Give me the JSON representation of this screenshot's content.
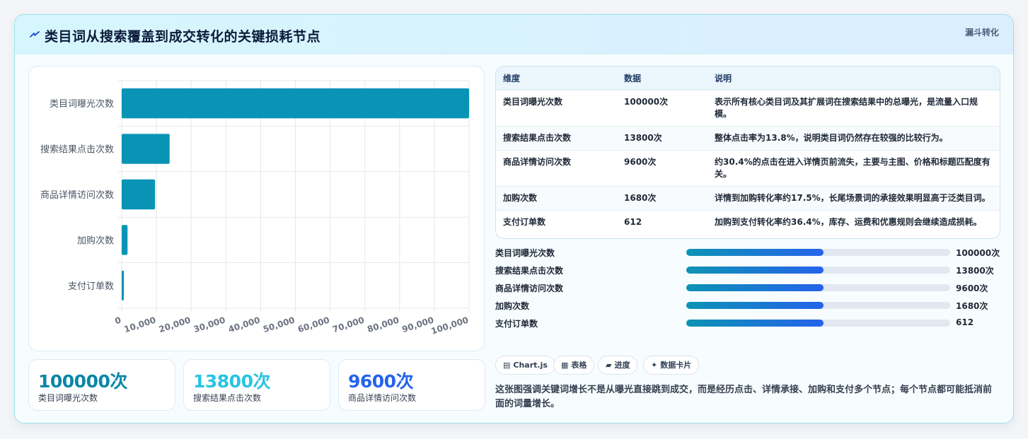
{
  "header": {
    "title": "类目词从搜索覆盖到成交转化的关键损耗节点",
    "badge": "漏斗转化",
    "icon": "lightning-icon"
  },
  "chart_data": {
    "type": "bar",
    "orientation": "horizontal",
    "categories": [
      "类目词曝光次数",
      "搜索结果点击次数",
      "商品详情访问次数",
      "加购次数",
      "支付订单数"
    ],
    "values": [
      100000,
      13800,
      9600,
      1680,
      612
    ],
    "xlim": [
      0,
      100000
    ],
    "ticks": [
      "0",
      "10,000",
      "20,000",
      "30,000",
      "40,000",
      "50,000",
      "60,000",
      "70,000",
      "80,000",
      "90,000",
      "100,000"
    ],
    "grid": true,
    "bar_color": "#0994b6"
  },
  "kpis": [
    {
      "value": "100000次",
      "label": "类目词曝光次数",
      "color": "#0b87a8"
    },
    {
      "value": "13800次",
      "label": "搜索结果点击次数",
      "color": "#29c3e3"
    },
    {
      "value": "9600次",
      "label": "商品详情访问次数",
      "color": "#2563eb"
    }
  ],
  "table": {
    "headers": [
      "维度",
      "数据",
      "说明"
    ],
    "rows": [
      [
        "类目词曝光次数",
        "100000次",
        "表示所有核心类目词及其扩展词在搜索结果中的总曝光，是流量入口规模。"
      ],
      [
        "搜索结果点击次数",
        "13800次",
        "整体点击率为13.8%，说明类目词仍然存在较强的比较行为。"
      ],
      [
        "商品详情访问次数",
        "9600次",
        "约30.4%的点击在进入详情页前流失，主要与主图、价格和标题匹配度有关。"
      ],
      [
        "加购次数",
        "1680次",
        "详情到加购转化率约17.5%，长尾场景词的承接效果明显高于泛类目词。"
      ],
      [
        "支付订单数",
        "612",
        "加购到支付转化率约36.4%，库存、运费和优惠规则会继续造成损耗。"
      ]
    ]
  },
  "progress": [
    {
      "label": "类目词曝光次数",
      "value": "100000次",
      "fill": 0.52
    },
    {
      "label": "搜索结果点击次数",
      "value": "13800次",
      "fill": 0.52
    },
    {
      "label": "商品详情访问次数",
      "value": "9600次",
      "fill": 0.52
    },
    {
      "label": "加购次数",
      "value": "1680次",
      "fill": 0.52
    },
    {
      "label": "支付订单数",
      "value": "612",
      "fill": 0.52
    }
  ],
  "chips": [
    {
      "label": "Chart.js",
      "icon": "chart-icon",
      "glyph": "▤"
    },
    {
      "label": "表格",
      "icon": "table-icon",
      "glyph": "▦"
    },
    {
      "label": "进度",
      "icon": "progress-icon",
      "glyph": "▰"
    },
    {
      "label": "数据卡片",
      "icon": "sparkle-icon",
      "glyph": "✦"
    }
  ],
  "description": "这张图强调关键词增长不是从曝光直接跳到成交，而是经历点击、详情承接、加购和支付多个节点；每个节点都可能抵消前面的词量增长。"
}
